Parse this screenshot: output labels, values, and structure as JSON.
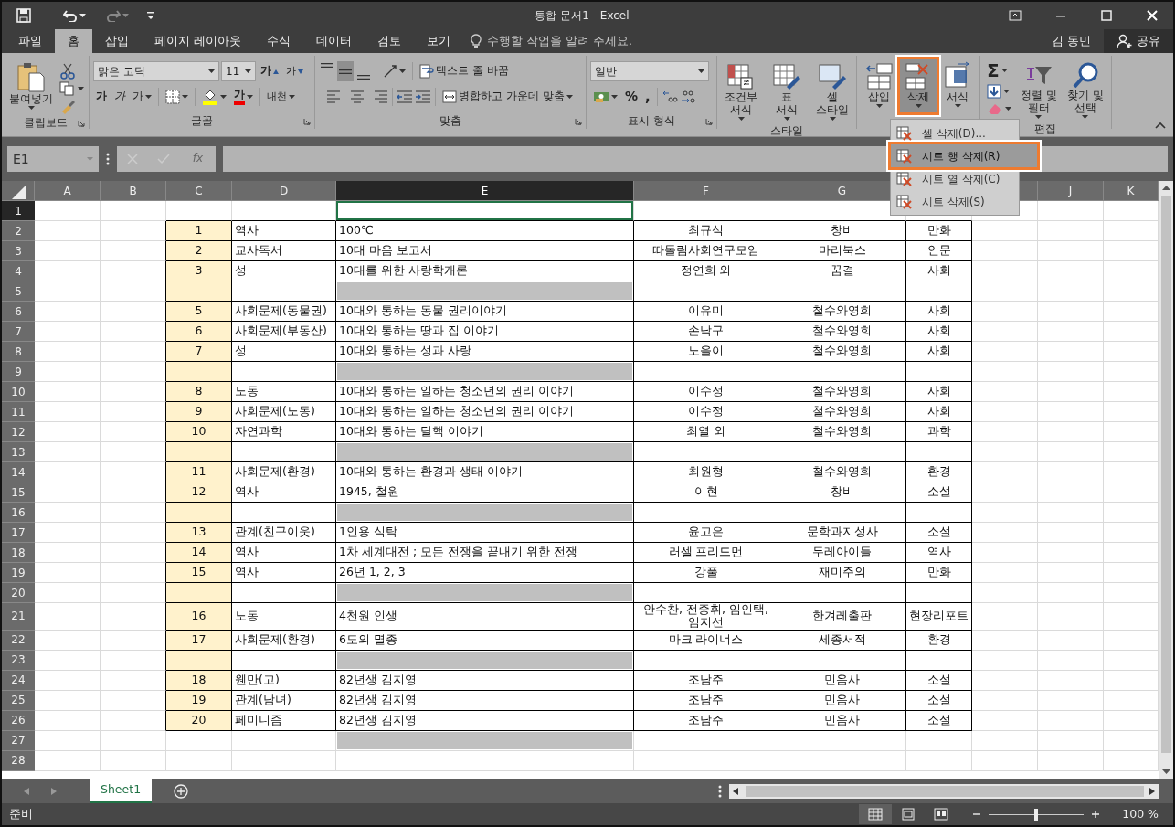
{
  "title_bar": {
    "title": "통합 문서1 - Excel",
    "redo_disabled": true
  },
  "menu_tabs": [
    {
      "label": "파일",
      "selected": false
    },
    {
      "label": "홈",
      "selected": true
    },
    {
      "label": "삽입",
      "selected": false
    },
    {
      "label": "페이지 레이아웃",
      "selected": false
    },
    {
      "label": "수식",
      "selected": false
    },
    {
      "label": "데이터",
      "selected": false
    },
    {
      "label": "검토",
      "selected": false
    },
    {
      "label": "보기",
      "selected": false
    }
  ],
  "tell_me": {
    "placeholder": "수행할 작업을 알려 주세요."
  },
  "user": "김 동민",
  "share": "공유",
  "ribbon": {
    "clipboard": {
      "paste": "붙여넣기",
      "label": "클립보드"
    },
    "font": {
      "font_name": "맑은 고딕",
      "font_size": "11",
      "grow": "가",
      "shrink": "가",
      "bold": "가",
      "italic": "가",
      "underline": "가",
      "font_color": "가",
      "phonetic": "내천",
      "label": "글꼴"
    },
    "alignment": {
      "vertical": [
        {
          "selected": false
        },
        {
          "selected": true
        },
        {
          "selected": false
        }
      ],
      "wrap": "텍스트 줄 바꿈",
      "merge": "병합하고 가운데 맞춤",
      "label": "맞춤"
    },
    "number": {
      "format": "일반",
      "percent": "%",
      "comma": ",",
      "label": "표시 형식"
    },
    "styles": {
      "buttons": [
        {
          "lines": [
            "조건부",
            "서식"
          ]
        },
        {
          "lines": [
            "표",
            "서식"
          ]
        },
        {
          "lines": [
            "셀",
            "스타일"
          ]
        }
      ],
      "label": "스타일"
    },
    "cells": {
      "buttons": [
        {
          "lines": [
            "삽입"
          ],
          "selected": false,
          "highlighted": false
        },
        {
          "lines": [
            "삭제"
          ],
          "selected": true,
          "highlighted": true
        },
        {
          "lines": [
            "서식"
          ],
          "selected": false,
          "highlighted": false
        }
      ]
    },
    "editing": {
      "autosum": "Σ",
      "buttons": [
        {
          "lines": [
            "정렬 및",
            "필터"
          ]
        },
        {
          "lines": [
            "찾기 및",
            "선택"
          ]
        }
      ],
      "label": "편집"
    }
  },
  "delete_menu": [
    {
      "label": "셀 삭제(D)...",
      "selected": false,
      "highlighted": false
    },
    {
      "label": "시트 행 삭제(R)",
      "selected": true,
      "highlighted": true
    },
    {
      "label": "시트 열 삭제(C)",
      "selected": false,
      "highlighted": false
    },
    {
      "label": "시트 삭제(S)",
      "selected": false,
      "highlighted": false
    }
  ],
  "formula_bar": {
    "name_box": "E1",
    "function_button": "fx"
  },
  "columns": [
    {
      "label": "A",
      "selected": false
    },
    {
      "label": "B",
      "selected": false
    },
    {
      "label": "C",
      "selected": false
    },
    {
      "label": "D",
      "selected": false
    },
    {
      "label": "E",
      "selected": true
    },
    {
      "label": "F",
      "selected": false
    },
    {
      "label": "G",
      "selected": false
    },
    {
      "label": "J",
      "selected": false
    },
    {
      "label": "K",
      "selected": false
    }
  ],
  "rows": [
    {
      "number": "1",
      "kind": "empty",
      "selected": true
    },
    {
      "number": "2",
      "kind": "data",
      "selected": false,
      "cells": [
        "1",
        "역사",
        "100℃",
        "최규석",
        "창비",
        "만화"
      ]
    },
    {
      "number": "3",
      "kind": "data",
      "selected": false,
      "cells": [
        "2",
        "교사독서",
        "10대 마음 보고서",
        "따돌림사회연구모임",
        "마리북스",
        "인문"
      ]
    },
    {
      "number": "4",
      "kind": "data",
      "selected": false,
      "cells": [
        "3",
        "성",
        "10대를 위한 사랑학개론",
        "정연희 외",
        "꿈결",
        "사회"
      ]
    },
    {
      "number": "5",
      "kind": "gap",
      "selected": false
    },
    {
      "number": "6",
      "kind": "data",
      "selected": false,
      "cells": [
        "5",
        "사회문제(동물권)",
        "10대와 통하는 동물 권리이야기",
        "이유미",
        "철수와영희",
        "사회"
      ]
    },
    {
      "number": "7",
      "kind": "data",
      "selected": false,
      "cells": [
        "6",
        "사회문제(부동산)",
        "10대와 통하는 땅과 집 이야기",
        "손낙구",
        "철수와영희",
        "사회"
      ]
    },
    {
      "number": "8",
      "kind": "data",
      "selected": false,
      "cells": [
        "7",
        "성",
        "10대와 통하는 성과 사랑",
        "노을이",
        "철수와영희",
        "사회"
      ]
    },
    {
      "number": "9",
      "kind": "gap",
      "selected": false
    },
    {
      "number": "10",
      "kind": "data",
      "selected": false,
      "cells": [
        "8",
        "노동",
        "10대와 통하는 일하는 청소년의 권리 이야기",
        "이수정",
        "철수와영희",
        "사회"
      ]
    },
    {
      "number": "11",
      "kind": "data",
      "selected": false,
      "cells": [
        "9",
        "사회문제(노동)",
        "10대와 통하는 일하는 청소년의 권리 이야기",
        "이수정",
        "철수와영희",
        "사회"
      ]
    },
    {
      "number": "12",
      "kind": "data",
      "selected": false,
      "cells": [
        "10",
        "자연과학",
        "10대와 통하는 탈핵 이야기",
        "최열 외",
        "철수와영희",
        "과학"
      ]
    },
    {
      "number": "13",
      "kind": "gap",
      "selected": false
    },
    {
      "number": "14",
      "kind": "data",
      "selected": false,
      "cells": [
        "11",
        "사회문제(환경)",
        "10대와 통하는 환경과 생태 이야기",
        "최원형",
        "철수와영희",
        "환경"
      ]
    },
    {
      "number": "15",
      "kind": "data",
      "selected": false,
      "cells": [
        "12",
        "역사",
        "1945, 철원",
        "이현",
        "창비",
        "소설"
      ]
    },
    {
      "number": "16",
      "kind": "gap",
      "selected": false
    },
    {
      "number": "17",
      "kind": "data",
      "selected": false,
      "cells": [
        "13",
        "관계(친구이웃)",
        "1인용 식탁",
        "윤고은",
        "문학과지성사",
        "소설"
      ]
    },
    {
      "number": "18",
      "kind": "data",
      "selected": false,
      "cells": [
        "14",
        "역사",
        "1차 세계대전 ; 모든 전쟁을 끝내기 위한 전쟁",
        "러셀 프리드먼",
        "두레아이들",
        "역사"
      ]
    },
    {
      "number": "19",
      "kind": "data",
      "selected": false,
      "cells": [
        "15",
        "역사",
        "26년 1, 2, 3",
        "강풀",
        "재미주의",
        "만화"
      ]
    },
    {
      "number": "20",
      "kind": "gap",
      "selected": false
    },
    {
      "number": "21",
      "kind": "data",
      "selected": false,
      "cells": [
        "16",
        "노동",
        "4천원 인생",
        "안수찬, 전종휘, 임인택, 임지선",
        "한겨레출판",
        "현장리포트"
      ]
    },
    {
      "number": "22",
      "kind": "data",
      "selected": false,
      "cells": [
        "17",
        "사회문제(환경)",
        "6도의 멸종",
        "마크 라이너스",
        "세종서적",
        "환경"
      ]
    },
    {
      "number": "23",
      "kind": "gap",
      "selected": false
    },
    {
      "number": "24",
      "kind": "data",
      "selected": false,
      "cells": [
        "18",
        "웬만(고)",
        "82년생 김지영",
        "조남주",
        "민음사",
        "소설"
      ]
    },
    {
      "number": "25",
      "kind": "data",
      "selected": false,
      "cells": [
        "19",
        "관계(남녀)",
        "82년생 김지영",
        "조남주",
        "민음사",
        "소설"
      ]
    },
    {
      "number": "26",
      "kind": "data",
      "selected": false,
      "cells": [
        "20",
        "페미니즘",
        "82년생 김지영",
        "조남주",
        "민음사",
        "소설"
      ]
    },
    {
      "number": "27",
      "kind": "shaded",
      "selected": false
    },
    {
      "number": "28",
      "kind": "empty",
      "selected": false
    }
  ],
  "sheet_tabs": [
    {
      "label": "Sheet1",
      "selected": true
    }
  ],
  "status_bar": {
    "status": "준비",
    "views": [
      {
        "selected": true
      },
      {
        "selected": false
      },
      {
        "selected": false
      }
    ],
    "zoom_slider": {
      "level": 0.5
    },
    "zoom": "100 %"
  }
}
